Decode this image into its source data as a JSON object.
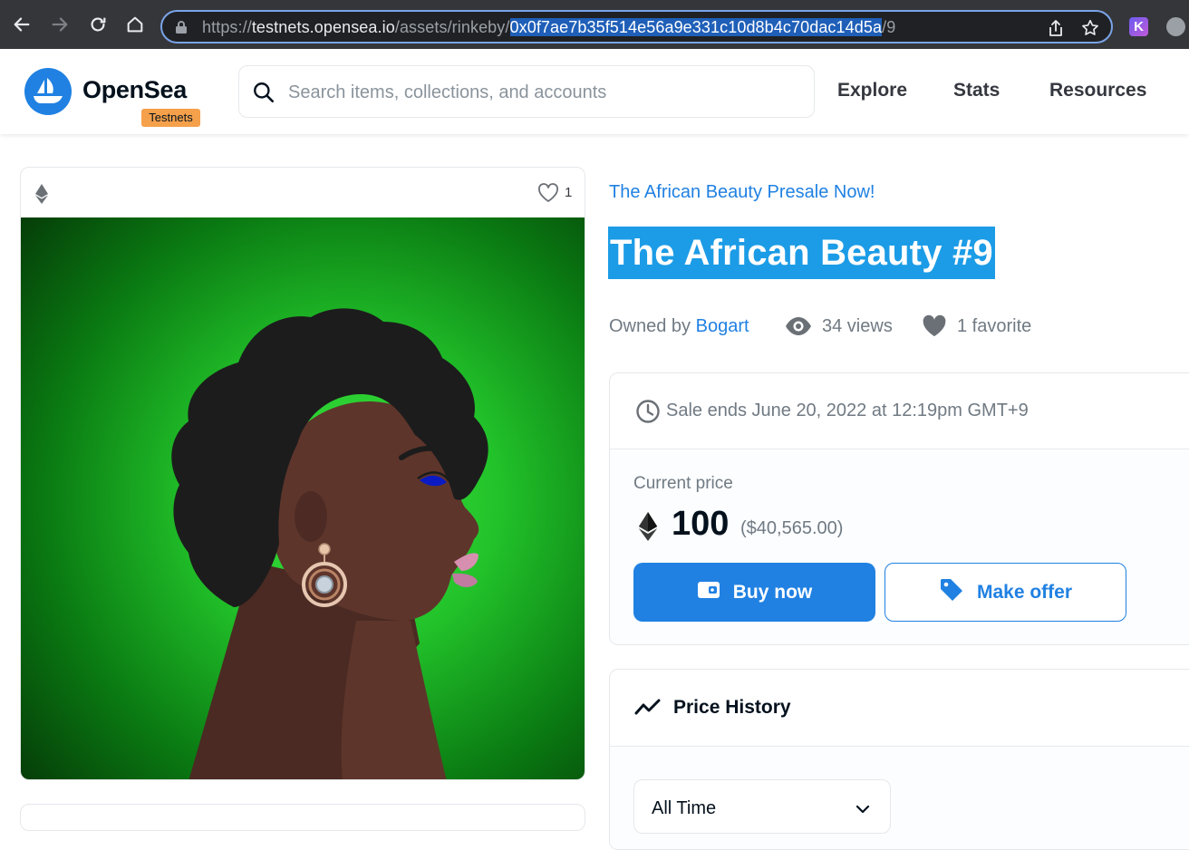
{
  "browser": {
    "url_scheme": "https://",
    "url_host": "testnets.opensea.io",
    "url_path": "/assets/rinkeby/",
    "url_contract": "0x0f7ae7b35f514e56a9e331c10d8b4c70dac14d5a",
    "url_token": "/9",
    "extension_k_label": "K"
  },
  "header": {
    "logo_text": "OpenSea",
    "badge": "Testnets",
    "search_placeholder": "Search items, collections, and accounts",
    "nav": [
      "Explore",
      "Stats",
      "Resources"
    ]
  },
  "media": {
    "favorite_count": "1"
  },
  "asset": {
    "collection": "The African Beauty Presale Now!",
    "title": "The African Beauty #9",
    "owned_by_label": "Owned by",
    "owner": "Bogart",
    "views": "34 views",
    "favorites": "1 favorite"
  },
  "sale": {
    "ends_text": "Sale ends June 20, 2022 at 12:19pm GMT+9",
    "price_label": "Current price",
    "price": "100",
    "price_usd": "($40,565.00)",
    "buy_label": "Buy now",
    "offer_label": "Make offer"
  },
  "history": {
    "title": "Price History",
    "range_value": "All Time"
  },
  "colors": {
    "brand_blue": "#2081e2",
    "testnets_orange": "#f5a04a",
    "title_highlight": "#1c9ce6"
  }
}
